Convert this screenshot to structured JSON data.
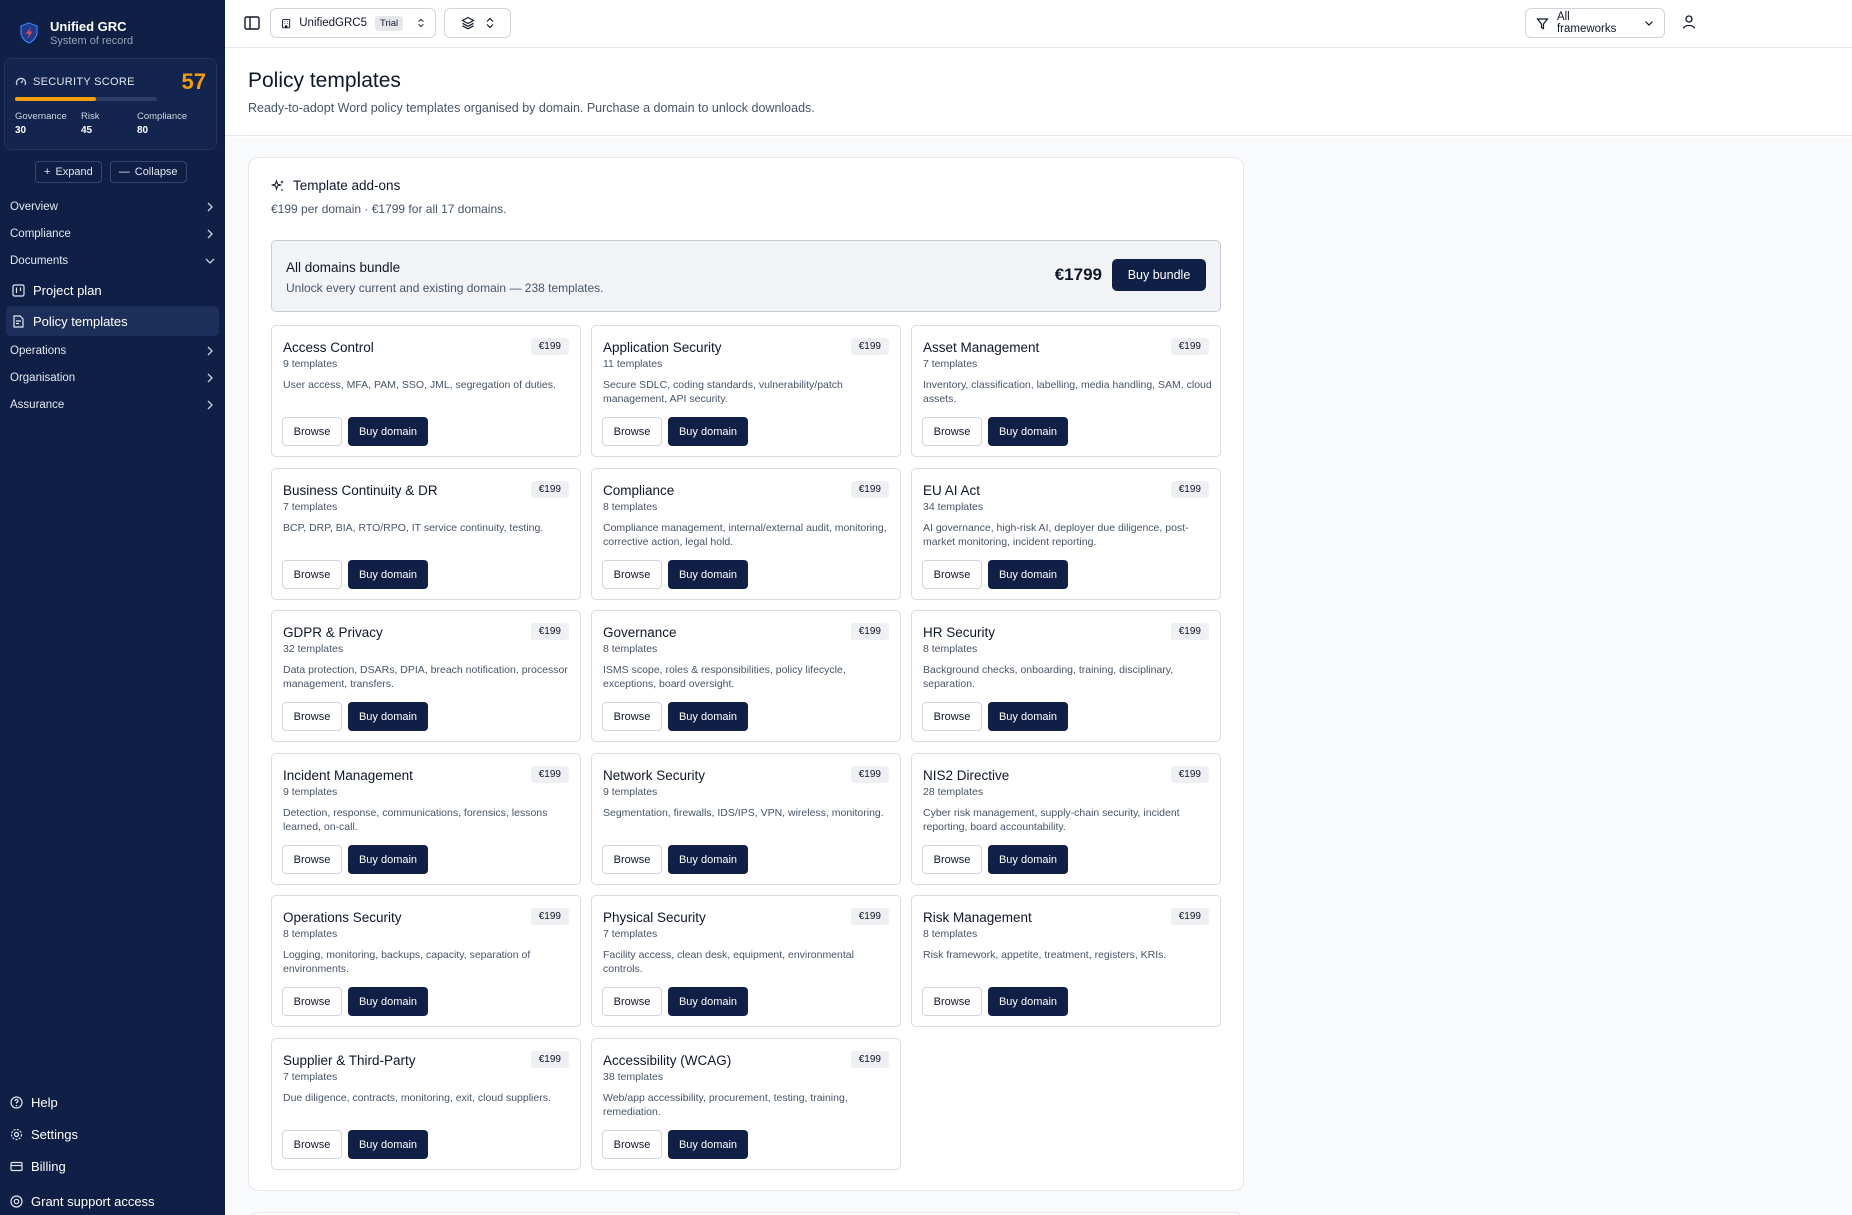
{
  "app": {
    "title": "Unified GRC",
    "subtitle": "System of record"
  },
  "security_score": {
    "label": "SECURITY SCORE",
    "value": "57",
    "progress_fraction": 0.57,
    "governance_label": "Governance",
    "governance_value": "30",
    "risk_label": "Risk",
    "risk_value": "45",
    "compliance_label": "Compliance",
    "compliance_value": "80"
  },
  "sidebar": {
    "expand_label": "Expand",
    "collapse_label": "Collapse",
    "overview": "Overview",
    "compliance": "Compliance",
    "documents": "Documents",
    "project_plan": "Project plan",
    "policy_templates": "Policy templates",
    "operations": "Operations",
    "organisation": "Organisation",
    "assurance": "Assurance",
    "help": "Help",
    "settings": "Settings",
    "billing": "Billing",
    "grant_support": "Grant support access"
  },
  "topbar": {
    "org_name": "UnifiedGRC5",
    "trial_badge": "Trial",
    "frameworks_label": "All frameworks"
  },
  "page": {
    "title": "Policy templates",
    "subtitle": "Ready-to-adopt Word policy templates organised by domain. Purchase a domain to unlock downloads."
  },
  "addons": {
    "title": "Template add-ons",
    "subtitle": "€199 per domain · €1799 for all 17 domains.",
    "bundle_title": "All domains bundle",
    "bundle_sub": "Unlock every current and existing domain — 238 templates.",
    "bundle_price": "€1799",
    "bundle_button": "Buy bundle"
  },
  "card_labels": {
    "browse": "Browse",
    "buy": "Buy domain"
  },
  "domains": [
    {
      "title": "Access Control",
      "count": "9 templates",
      "desc": "User access, MFA, PAM, SSO, JML, segregation of duties.",
      "price": "€199"
    },
    {
      "title": "Application Security",
      "count": "11 templates",
      "desc": "Secure SDLC, coding standards, vulnerability/patch management, API security.",
      "price": "€199"
    },
    {
      "title": "Asset Management",
      "count": "7 templates",
      "desc": "Inventory, classification, labelling, media handling, SAM, cloud assets.",
      "price": "€199"
    },
    {
      "title": "Business Continuity & DR",
      "count": "7 templates",
      "desc": "BCP, DRP, BIA, RTO/RPO, IT service continuity, testing.",
      "price": "€199"
    },
    {
      "title": "Compliance",
      "count": "8 templates",
      "desc": "Compliance management, internal/external audit, monitoring, corrective action, legal hold.",
      "price": "€199"
    },
    {
      "title": "EU AI Act",
      "count": "34 templates",
      "desc": "AI governance, high-risk AI, deployer due diligence, post-market monitoring, incident reporting.",
      "price": "€199"
    },
    {
      "title": "GDPR & Privacy",
      "count": "32 templates",
      "desc": "Data protection, DSARs, DPIA, breach notification, processor management, transfers.",
      "price": "€199"
    },
    {
      "title": "Governance",
      "count": "8 templates",
      "desc": "ISMS scope, roles & responsibilities, policy lifecycle, exceptions, board oversight.",
      "price": "€199"
    },
    {
      "title": "HR Security",
      "count": "8 templates",
      "desc": "Background checks, onboarding, training, disciplinary, separation.",
      "price": "€199"
    },
    {
      "title": "Incident Management",
      "count": "9 templates",
      "desc": "Detection, response, communications, forensics, lessons learned, on-call.",
      "price": "€199"
    },
    {
      "title": "Network Security",
      "count": "9 templates",
      "desc": "Segmentation, firewalls, IDS/IPS, VPN, wireless, monitoring.",
      "price": "€199"
    },
    {
      "title": "NIS2 Directive",
      "count": "28 templates",
      "desc": "Cyber risk management, supply-chain security, incident reporting, board accountability.",
      "price": "€199"
    },
    {
      "title": "Operations Security",
      "count": "8 templates",
      "desc": "Logging, monitoring, backups, capacity, separation of environments.",
      "price": "€199"
    },
    {
      "title": "Physical Security",
      "count": "7 templates",
      "desc": "Facility access, clean desk, equipment, environmental controls.",
      "price": "€199"
    },
    {
      "title": "Risk Management",
      "count": "8 templates",
      "desc": "Risk framework, appetite, treatment, registers, KRIs.",
      "price": "€199"
    },
    {
      "title": "Supplier & Third-Party",
      "count": "7 templates",
      "desc": "Due diligence, contracts, monitoring, exit, cloud suppliers.",
      "price": "€199"
    },
    {
      "title": "Accessibility (WCAG)",
      "count": "38 templates",
      "desc": "Web/app accessibility, procurement, testing, training, remediation.",
      "price": "€199"
    }
  ],
  "colors": {
    "sidebar_bg": "#0f1f45",
    "accent": "#f59e0b",
    "primary_button": "#0f1f45"
  }
}
